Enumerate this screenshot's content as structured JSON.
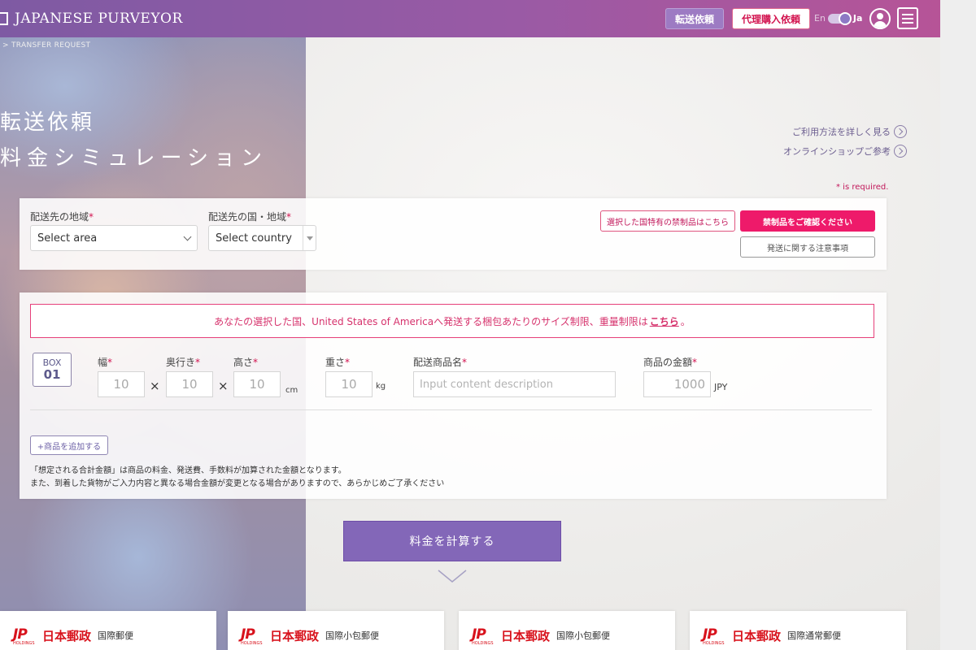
{
  "header": {
    "logo": "JAPANESE PURVEYOR",
    "transfer_request_btn": "転送依頼",
    "proxy_purchase_btn": "代理購入依頼",
    "lang_en": "En",
    "lang_ja": "Ja"
  },
  "breadcrumb": "> TRANSFER REQUEST",
  "page": {
    "title_line1": "転送依頼",
    "title_line2": "料金シミュレーション",
    "link_howto": "ご利用方法を詳しく見る",
    "link_shop": "オンラインショップご参考",
    "required_note": "* is required."
  },
  "destination": {
    "area_label": "配送先の地域",
    "area_select": "Select area",
    "country_label": "配送先の国・地域",
    "country_select": "Select country",
    "required_mark": "*",
    "btn_prohibited_country": "選択した国特有の禁制品はこちら",
    "btn_check_prohibited": "禁制品をご確認ください",
    "btn_shipping_notes": "発送に関する注意事項"
  },
  "box": {
    "notice_text": "あなたの選択した国、United States of Americaへ発送する梱包あたりのサイズ制限、重量制限は",
    "notice_link": "こちら",
    "notice_end": "。",
    "box_word": "BOX",
    "box_number": "01",
    "width_label": "幅",
    "depth_label": "奥行き",
    "height_label": "高さ",
    "weight_label": "重さ",
    "content_label": "配送商品名",
    "value_label": "商品の金額",
    "width_value": "10",
    "depth_value": "10",
    "height_value": "10",
    "weight_value": "10",
    "content_placeholder": "Input content description",
    "value_value": "1000",
    "unit_cm": "cm",
    "unit_kg": "kg",
    "unit_jpy": "JPY",
    "times": "×",
    "add_item_btn": "+商品を追加する",
    "note1": "「想定される合計金額」は商品の料金、発送費、手数料が加算された金額となります。",
    "note2": "また、到着した貨物がご入力内容と異なる場合金額が変更となる場合がありますので、あらかじめご了承ください"
  },
  "calculate_btn": "料金を計算する",
  "cards": [
    {
      "logo": "JP",
      "logo_sub": "HOLDINGS",
      "brand": "日本郵政",
      "service": "国際郵便"
    },
    {
      "logo": "JP",
      "logo_sub": "HOLDINGS",
      "brand": "日本郵政",
      "service": "国際小包郵便"
    },
    {
      "logo": "JP",
      "logo_sub": "HOLDINGS",
      "brand": "日本郵政",
      "service": "国際小包郵便"
    },
    {
      "logo": "JP",
      "logo_sub": "HOLDINGS",
      "brand": "日本郵政",
      "service": "国際通常郵便"
    }
  ],
  "colors": {
    "header_start": "#7e5aa3",
    "header_end": "#b65497",
    "accent_pink": "#ee1a6a",
    "calc_button": "#8367b8",
    "japan_post_red": "#d8121c"
  },
  "icons": [
    "logo-mark-icon",
    "avatar-icon",
    "menu-icon",
    "arrow-circle-icon",
    "chevron-down-icon",
    "select-triangle-icon"
  ]
}
